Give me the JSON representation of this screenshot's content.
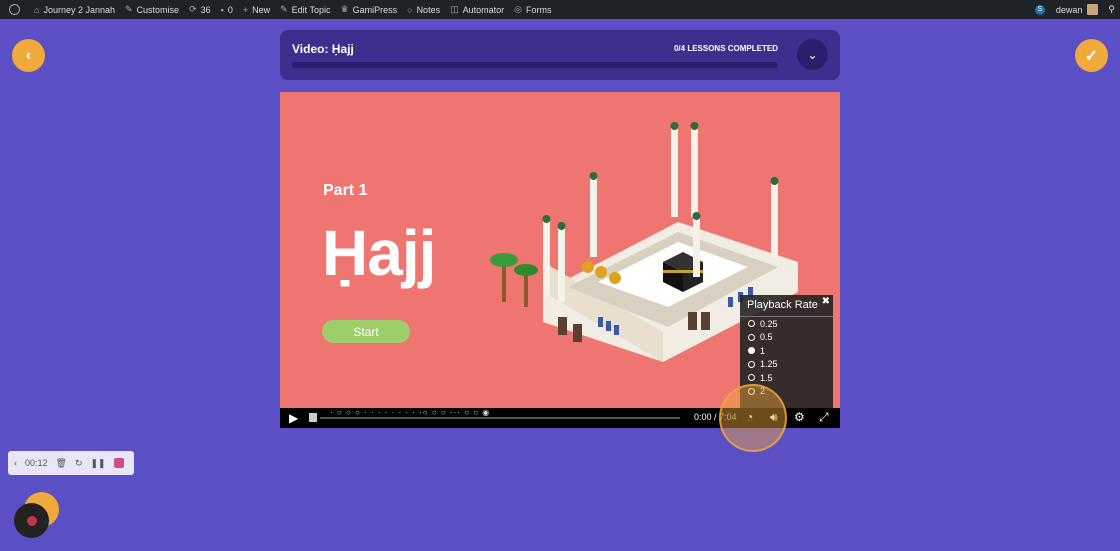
{
  "adminbar": {
    "items": [
      {
        "icon": "home-icon",
        "label": "Journey 2 Jannah"
      },
      {
        "icon": "brush-icon",
        "label": "Customise"
      },
      {
        "icon": "update-icon",
        "label": "36"
      },
      {
        "icon": "comment-icon",
        "label": "0"
      },
      {
        "icon": "plus-icon",
        "label": "New"
      },
      {
        "icon": "pencil-icon",
        "label": "Edit Topic"
      },
      {
        "icon": "gamipress-icon",
        "label": "GamiPress"
      },
      {
        "icon": "notes-icon",
        "label": "Notes"
      },
      {
        "icon": "automator-icon",
        "label": "Automator"
      },
      {
        "icon": "forms-icon",
        "label": "Forms"
      }
    ],
    "user": "dewan",
    "badge": "S"
  },
  "lesson": {
    "title": "Video: Ḥajj",
    "status": "0/4 LESSONS COMPLETED",
    "progress": 0
  },
  "video": {
    "part": "Part 1",
    "title": "Ḥajj",
    "start_label": "Start"
  },
  "playback": {
    "title": "Playback Rate",
    "rates": [
      "0.25",
      "0.5",
      "1",
      "1.25",
      "1.5",
      "2"
    ],
    "selected": "1"
  },
  "player": {
    "current_time": "0:00",
    "duration": "7:04"
  },
  "recorder": {
    "time": "00:12"
  },
  "colors": {
    "background": "#5b4fc6",
    "accent": "#f0a93b",
    "video_bg": "#ef7670",
    "start_button": "#9ccf6a"
  }
}
